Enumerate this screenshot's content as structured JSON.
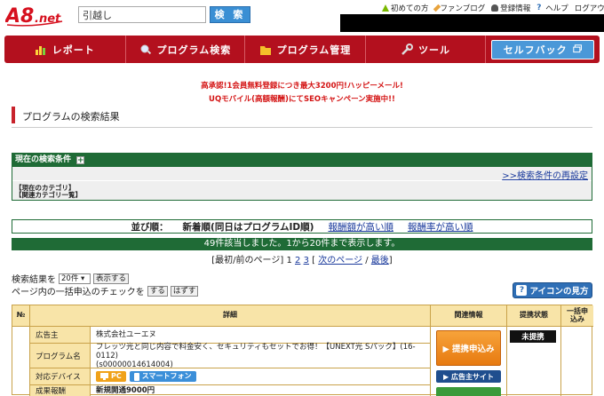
{
  "header": {
    "logo_text": "A8.net",
    "search_value": "引越し",
    "search_button": "検 索",
    "toplinks": [
      {
        "label": "初めての方",
        "icon": "beginner-icon",
        "color": "#7ab800"
      },
      {
        "label": "ファンブログ",
        "icon": "pencil-icon",
        "color": "#e8a33d"
      },
      {
        "label": "登録情報",
        "icon": "user-icon",
        "color": "#555555"
      },
      {
        "label": "ヘルプ",
        "icon": "question-icon",
        "color": "#2f6fb6"
      },
      {
        "label": "ログアウト",
        "icon": "logout-icon",
        "color": "#777777"
      }
    ]
  },
  "nav": {
    "items": [
      {
        "label": "レポート",
        "icon": "chart-icon"
      },
      {
        "label": "プログラム検索",
        "icon": "magnifier-icon"
      },
      {
        "label": "プログラム管理",
        "icon": "folder-icon"
      },
      {
        "label": "ツール",
        "icon": "wrench-icon"
      }
    ],
    "selfback": {
      "label": "セルフバック",
      "icon": "window-icon"
    }
  },
  "campaign": {
    "line1": "高承認!1会員無料登録につき最大3200円!ハッピーメール!",
    "line2": "UQモバイル(高額報酬)にてSEOキャンペーン実施中!!"
  },
  "page_title": "プログラムの検索結果",
  "conditions": {
    "header": "現在の検索条件",
    "plus": "+",
    "reset_link": ">>検索条件の再設定",
    "category_current": "【現在のカテゴリ】",
    "category_related": "【関連カテゴリ一覧】"
  },
  "sort": {
    "label": "並び順：",
    "current": "新着順(同日はプログラムID順)",
    "option_reward": "報酬額が高い順",
    "option_rate": "報酬率が高い順"
  },
  "results": {
    "count_text": "49件該当しました。1から20件まで表示します。",
    "pager_prefix": "[最初/前のページ]",
    "page_current": "1",
    "page_2": "2",
    "page_3": "3",
    "pager_next": "次のページ",
    "pager_last": "最後",
    "bracket_open": "[",
    "slash": "/",
    "bracket_close": "]"
  },
  "controls": {
    "per_page_label": "検索結果を",
    "per_page_value": "20件",
    "show_button": "表示する",
    "bulk_label": "ページ内の一括申込のチェックを",
    "bulk_on": "する",
    "bulk_off": "はずす",
    "icon_help": "アイコンの見方",
    "icon_help_q": "?"
  },
  "table": {
    "headers": {
      "no": "№",
      "detail": "詳細",
      "related": "関連情報",
      "status": "提携状態",
      "bulk": "一括申込み"
    },
    "rows": [
      {
        "label": "広告主",
        "value": "株式会社ユーエヌ"
      },
      {
        "label": "プログラム名",
        "value": "フレッツ光と同じ内容で料金安く、セキュリティもセットでお得！【UNEXT光 Sパック】(16-0112)",
        "value2": "(s00000014614004)"
      },
      {
        "label": "対応デバイス",
        "pc": "PC",
        "sp": "スマートフォン"
      },
      {
        "label": "成果報酬",
        "value": "新規開通9000円"
      }
    ],
    "apply_button": "▶ 提携申込み",
    "advertiser_site": "▶ 広告主サイト",
    "status_badge": "未提携"
  },
  "colors": {
    "nav_red": "#b3101e",
    "dark_green": "#1f6b36",
    "header_gold": "#f8e4a8",
    "campaign_red": "#d41414"
  }
}
